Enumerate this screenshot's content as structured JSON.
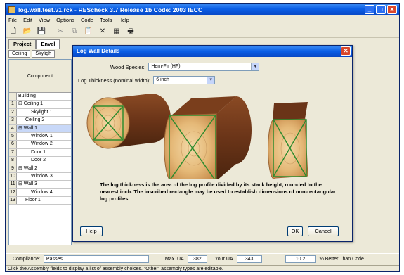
{
  "window": {
    "title": "log.wall.test.v1.rck - REScheck 3.7 Release 1b        Code: 2003 IECC",
    "min": "_",
    "max": "□",
    "close": "✕"
  },
  "menu": [
    "File",
    "Edit",
    "View",
    "Options",
    "Code",
    "Tools",
    "Help"
  ],
  "tabs": [
    "Project",
    "Envel"
  ],
  "subtabs": [
    "Ceiling",
    "Skyligh"
  ],
  "table": {
    "column_header": "Component",
    "rows": [
      {
        "num": "",
        "label": "Building"
      },
      {
        "num": "1",
        "label": "⊟ Ceiling 1"
      },
      {
        "num": "2",
        "label": "Skylight 1"
      },
      {
        "num": "3",
        "label": "Ceiling 2"
      },
      {
        "num": "4",
        "label": "⊟ Wall 1"
      },
      {
        "num": "5",
        "label": "Window 1"
      },
      {
        "num": "6",
        "label": "Window 2"
      },
      {
        "num": "7",
        "label": "Door 1"
      },
      {
        "num": "8",
        "label": "Door 2"
      },
      {
        "num": "9",
        "label": "⊟ Wall 2"
      },
      {
        "num": "10",
        "label": "Window 3"
      },
      {
        "num": "11",
        "label": "⊟ Wall 3"
      },
      {
        "num": "12",
        "label": "Window 4"
      },
      {
        "num": "13",
        "label": "Floor 1"
      }
    ]
  },
  "dialog": {
    "title": "Log Wall Details",
    "close": "✕",
    "species_label": "Wood Species:",
    "species_value": "Hem-Fir (HF)",
    "thickness_label": "Log Thickness (nominal width):",
    "thickness_value": "6 inch",
    "description": "The log thickness is the area of the log profile divided by its stack height, rounded to the nearest inch.  The inscribed rectangle may be used to establish dimensions of non-rectangular log profiles.",
    "help": "Help",
    "ok": "OK",
    "cancel": "Cancel"
  },
  "status": {
    "compliance_label": "Compliance:",
    "compliance_value": "Passes",
    "max_ua_label": "Max. UA",
    "max_ua_value": "382",
    "your_ua_label": "Your UA",
    "your_ua_value": "343",
    "better_value": "10.2",
    "better_label": "% Better Than Code"
  },
  "hint": "Click the Assembly fields to display a list of assembly choices.  \"Other\" assembly types are editable.",
  "colors": {
    "titlebar": "#0a5ee6",
    "wood_end": "#e0b070",
    "bark": "#6a3a1e",
    "inscribed": "#2e8b2e"
  }
}
